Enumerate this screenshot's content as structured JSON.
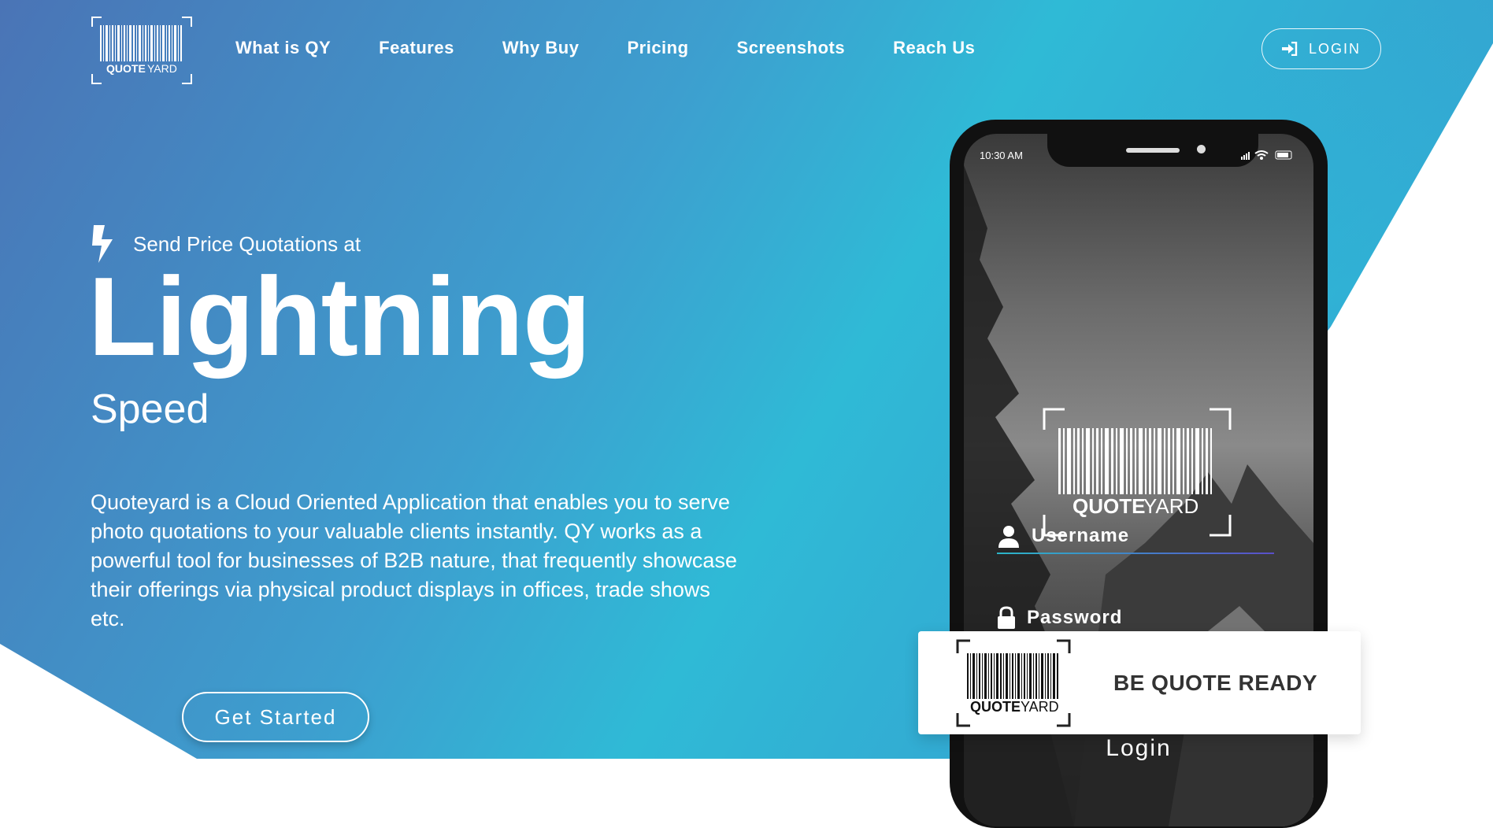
{
  "brand": {
    "logo_text": "QUOTE YARD",
    "logo_word1": "QUOTE",
    "logo_word2": "YARD"
  },
  "nav": {
    "items": [
      "What is QY",
      "Features",
      "Why Buy",
      "Pricing",
      "Screenshots",
      "Reach Us"
    ],
    "login_label": "LOGIN"
  },
  "hero": {
    "tagline": "Send Price Quotations at",
    "headline": "Lightning",
    "subheadline": "Speed",
    "description": "Quoteyard is a Cloud Oriented Application that enables you to serve photo quotations to your valuable clients instantly. QY works as a powerful tool for businesses of B2B nature, that frequently showcase their offerings via physical product displays in offices, trade shows etc.",
    "cta_label": "Get Started"
  },
  "phone": {
    "time": "10:30 AM",
    "username_label": "Username",
    "password_label": "Password",
    "login_label": "Login"
  },
  "card": {
    "text": "BE QUOTE READY"
  },
  "colors": {
    "hero_start": "#4a74b6",
    "hero_mid": "#2fbad6",
    "hero_end": "#3c91cd",
    "white": "#ffffff"
  }
}
